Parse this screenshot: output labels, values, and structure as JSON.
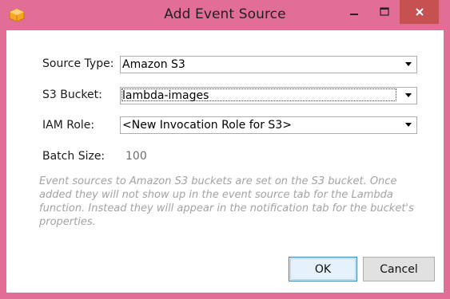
{
  "window": {
    "title": "Add Event Source",
    "controls": {
      "minimize": "minimize-icon",
      "maximize": "maximize-icon",
      "close": "close-icon"
    },
    "accent": "#e26e97"
  },
  "form": {
    "source_type": {
      "label": "Source Type:",
      "value": "Amazon S3"
    },
    "s3_bucket": {
      "label": "S3 Bucket:",
      "value": "lambda-images"
    },
    "iam_role": {
      "label": "IAM Role:",
      "value": "<New Invocation Role for S3>"
    },
    "batch_size": {
      "label": "Batch Size:",
      "value": "100"
    },
    "note": "Event sources to Amazon S3 buckets are set on the S3 bucket. Once added they will not show up in the event source tab for the Lambda function. Instead they will appear in the notification tab for the bucket's properties."
  },
  "buttons": {
    "ok": "OK",
    "cancel": "Cancel"
  }
}
